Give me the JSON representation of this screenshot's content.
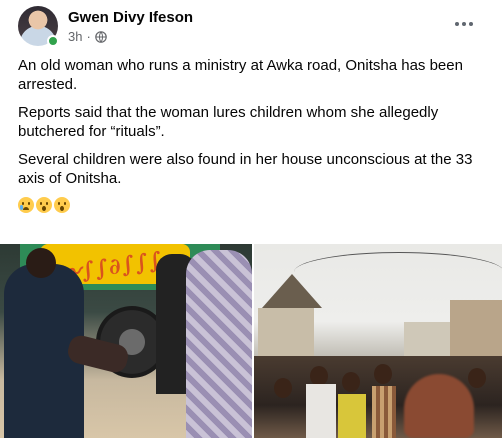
{
  "post": {
    "author": "Gwen Divy Ifeson",
    "time": "3h",
    "audience_icon": "globe-icon",
    "more_icon": "more-horizontal-icon",
    "paragraphs": [
      "An old woman who runs a ministry at Awka road, Onitsha has been arrested.",
      "Reports said that the woman lures children whom she allegedly butchered for “rituals”.",
      "Several children were also found in her house unconscious at the 33 axis of Onitsha."
    ],
    "emojis": [
      "crying-face-emoji",
      "astonished-face-emoji",
      "flushed-face-emoji"
    ]
  },
  "photos": [
    {
      "name": "truck-scene-photo"
    },
    {
      "name": "street-crowd-photo"
    }
  ],
  "colors": {
    "online": "#31a24c",
    "meta_text": "#65676b",
    "text": "#050505"
  }
}
